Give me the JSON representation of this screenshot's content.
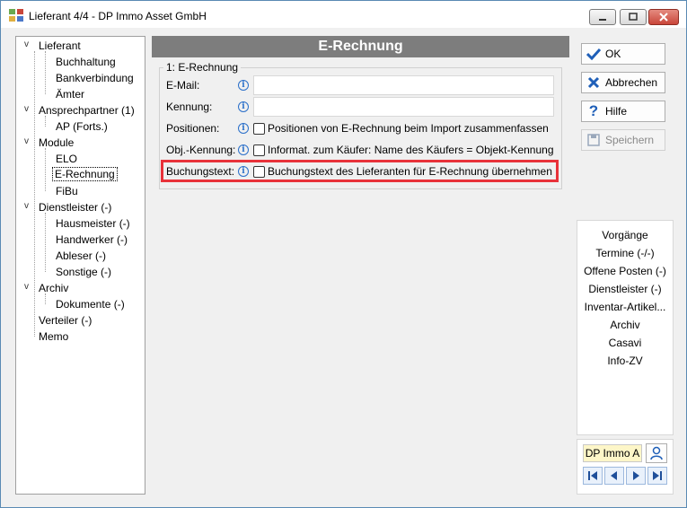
{
  "window": {
    "title": "Lieferant 4/4 - DP Immo Asset GmbH",
    "icon": "grid-app-icon"
  },
  "tree": {
    "items": [
      {
        "label": "Lieferant",
        "level": 0,
        "expanded": true
      },
      {
        "label": "Buchhaltung",
        "level": 1
      },
      {
        "label": "Bankverbindung",
        "level": 1
      },
      {
        "label": "Ämter",
        "level": 1
      },
      {
        "label": "Ansprechpartner (1)",
        "level": 0,
        "expanded": true
      },
      {
        "label": "AP (Forts.)",
        "level": 1
      },
      {
        "label": "Module",
        "level": 0,
        "expanded": true
      },
      {
        "label": "ELO",
        "level": 1
      },
      {
        "label": "E-Rechnung",
        "level": 1,
        "selected": true
      },
      {
        "label": "FiBu",
        "level": 1
      },
      {
        "label": "Dienstleister (-)",
        "level": 0,
        "expanded": true
      },
      {
        "label": "Hausmeister (-)",
        "level": 1
      },
      {
        "label": "Handwerker (-)",
        "level": 1
      },
      {
        "label": "Ableser (-)",
        "level": 1
      },
      {
        "label": "Sonstige (-)",
        "level": 1
      },
      {
        "label": "Archiv",
        "level": 0,
        "expanded": true
      },
      {
        "label": "Dokumente (-)",
        "level": 1
      },
      {
        "label": "Verteiler (-)",
        "level": 0
      },
      {
        "label": "Memo",
        "level": 0
      }
    ]
  },
  "content": {
    "header": "E-Rechnung",
    "group_title": "1: E-Rechnung",
    "fields": {
      "email_label": "E-Mail:",
      "email_value": "",
      "kennung_label": "Kennung:",
      "kennung_value": "",
      "positionen_label": "Positionen:",
      "positionen_checkbox": "Positionen von E-Rechnung beim Import zusammenfassen",
      "objkennung_label": "Obj.-Kennung:",
      "objkennung_checkbox": "Informat. zum Käufer: Name des Käufers = Objekt-Kennung",
      "buchungstext_label": "Buchungstext:",
      "buchungstext_checkbox": "Buchungstext des Lieferanten für E-Rechnung übernehmen"
    }
  },
  "actions": {
    "ok": "OK",
    "cancel": "Abbrechen",
    "help": "Hilfe",
    "save": "Speichern"
  },
  "side_links": [
    "Vorgänge",
    "Termine (-/-)",
    "Offene Posten (-)",
    "Dienstleister (-)",
    "Inventar-Artikel...",
    "Archiv",
    "Casavi",
    "Info-ZV"
  ],
  "bottom": {
    "name_badge": "DP Immo A"
  },
  "colors": {
    "header_bg": "#7d7d7d",
    "highlight": "#e8323a",
    "info_blue": "#2a6fc9",
    "badge_bg": "#fdf6c8"
  }
}
